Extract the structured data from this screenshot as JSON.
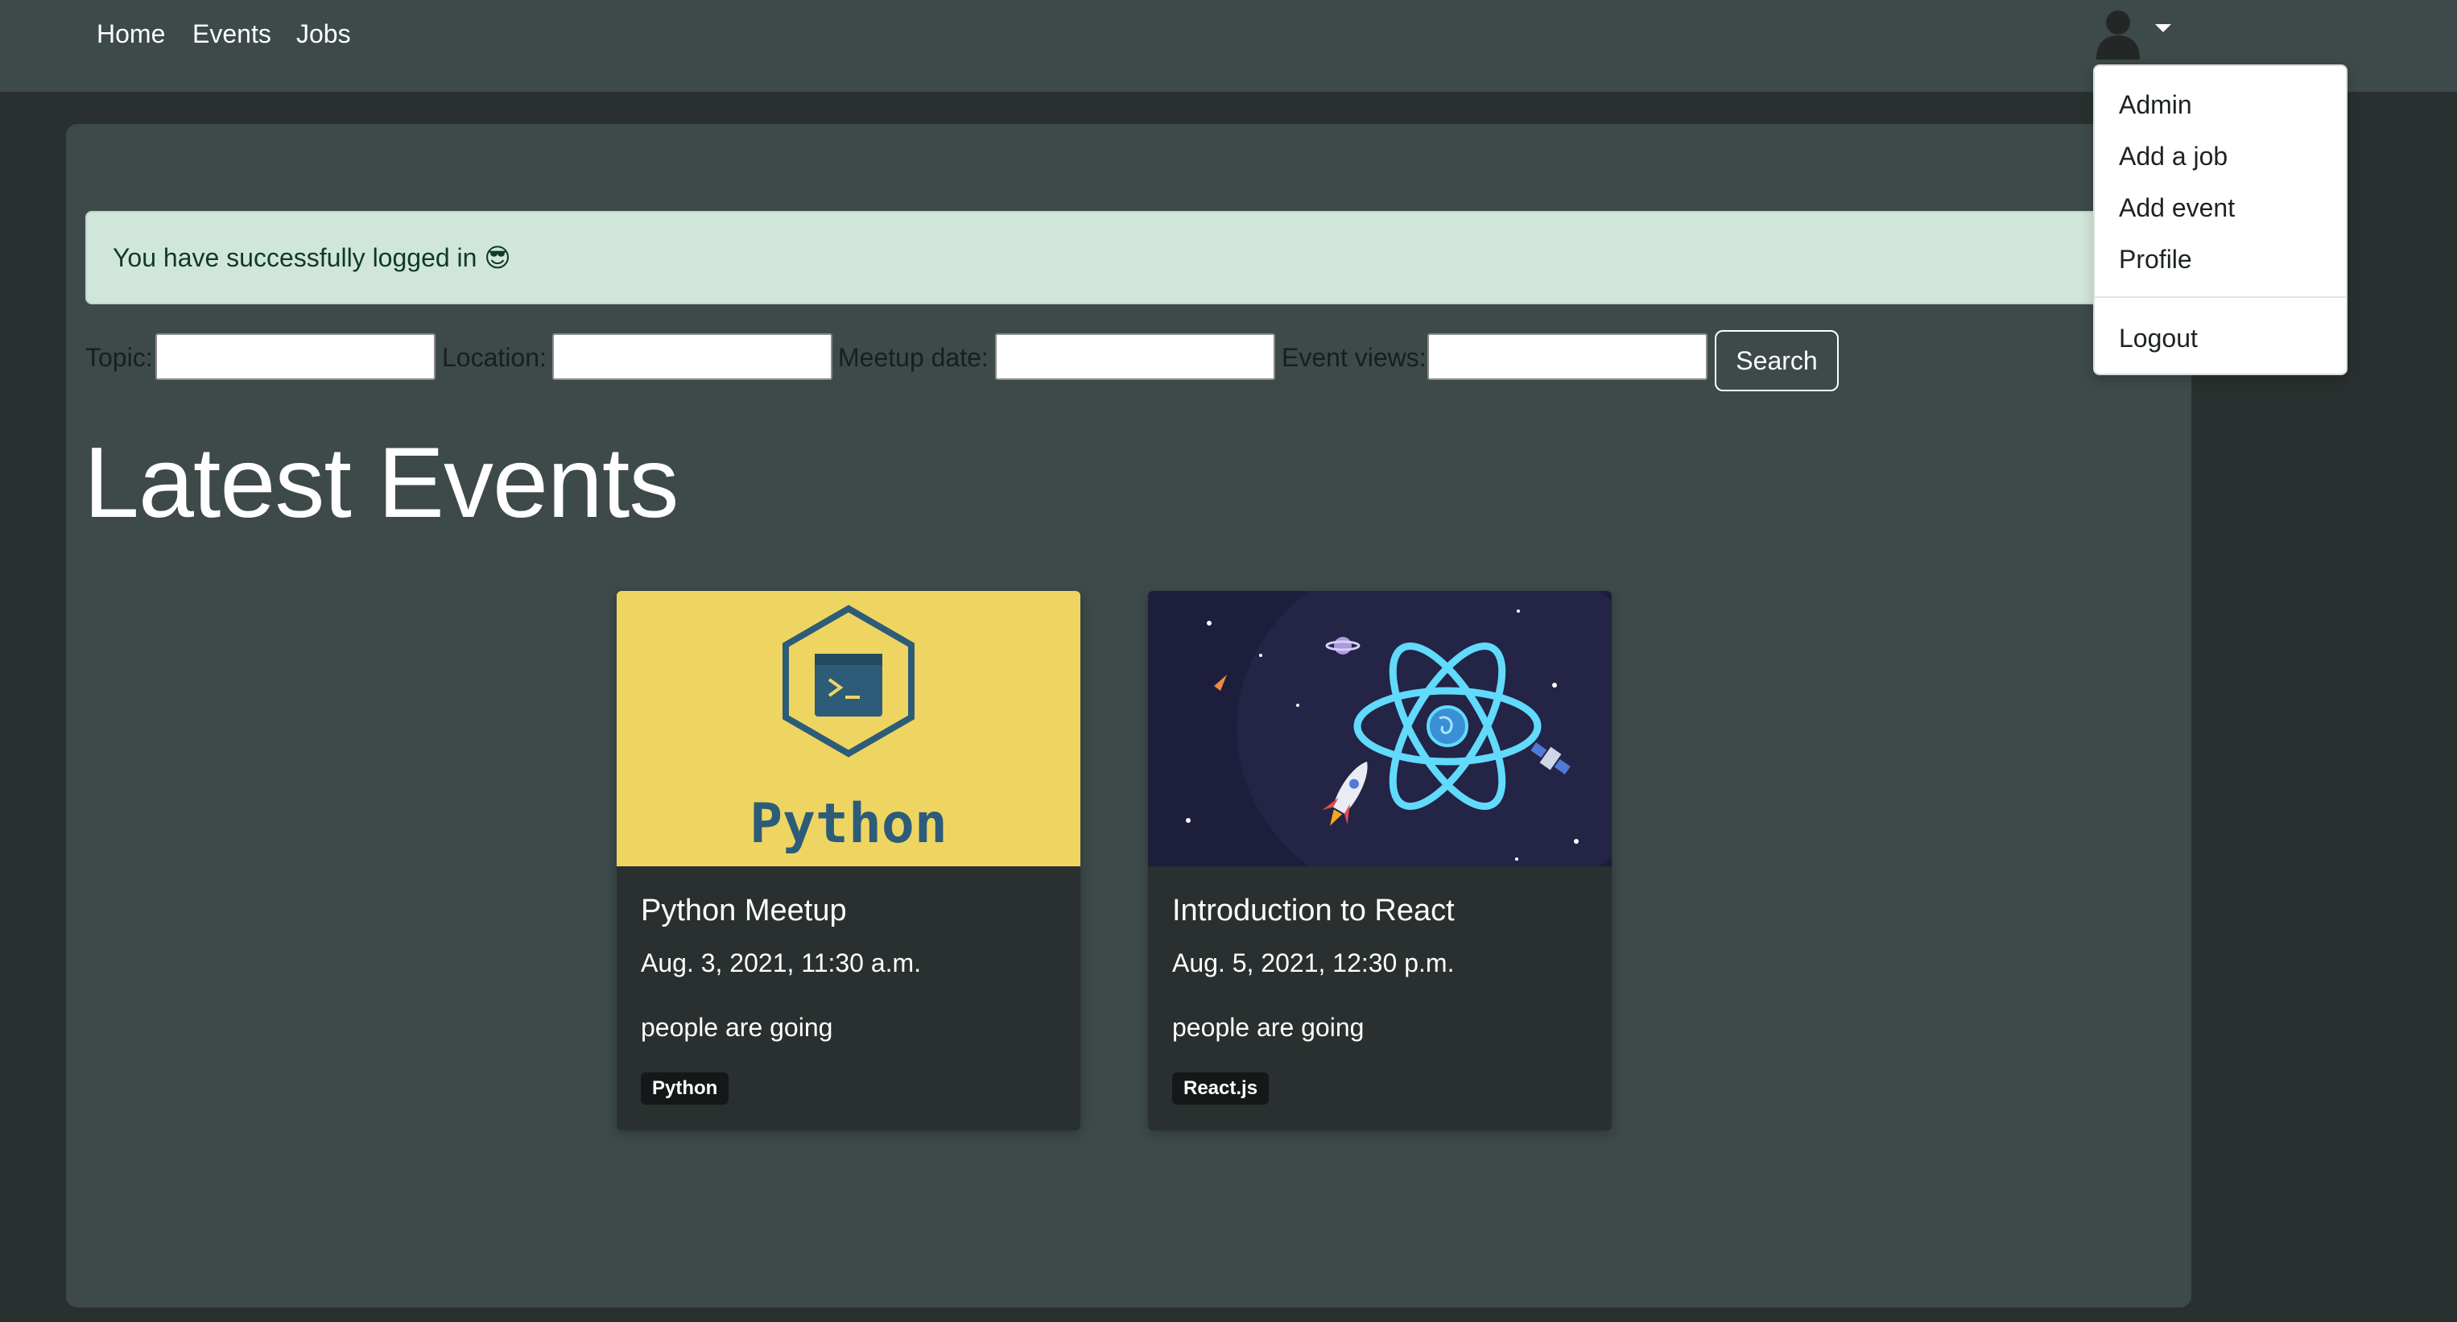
{
  "navbar": {
    "links": [
      "Home",
      "Events",
      "Jobs"
    ]
  },
  "user_menu": {
    "avatar_icon": "user-avatar-icon",
    "items": [
      "Admin",
      "Add a job",
      "Add event",
      "Profile"
    ],
    "logout_label": "Logout"
  },
  "alert": {
    "message": "You have successfully logged in 😎",
    "color": "#d1e6da"
  },
  "filters": {
    "topic_label": "Topic:",
    "location_label": "Location:",
    "meetup_date_label": "Meetup date:",
    "event_views_label": "Event views:",
    "topic_value": "",
    "location_value": "",
    "meetup_date_value": "",
    "event_views_value": "",
    "search_label": "Search"
  },
  "main": {
    "title": "Latest Events"
  },
  "events": [
    {
      "title": "Python Meetup",
      "date": "Aug. 3, 2021, 11:30 a.m.",
      "going": "people are going",
      "tag": "Python",
      "image_text": "Python",
      "image_color": "#eed562"
    },
    {
      "title": "Introduction to React",
      "date": "Aug. 5, 2021, 12:30 p.m.",
      "going": "people are going",
      "tag": "React.js",
      "image_color": "#1d1e3c"
    }
  ],
  "colors": {
    "navbar": "#3d4a49",
    "page_bg": "#29302f",
    "card_bg": "#29302f",
    "react_accent": "#61dafb"
  }
}
